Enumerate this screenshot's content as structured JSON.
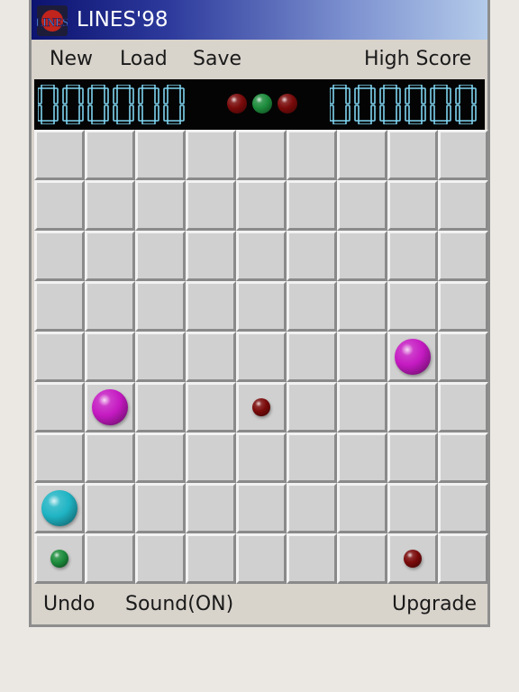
{
  "window": {
    "title": "LINES'98",
    "logo_text": "LINES"
  },
  "menu": {
    "new": "New",
    "load": "Load",
    "save": "Save",
    "high_score": "High Score"
  },
  "scores": {
    "current": "000000",
    "high": "000000"
  },
  "next_balls": [
    {
      "color": "#7a0a0a"
    },
    {
      "color": "#1d8c3c"
    },
    {
      "color": "#7a0a0a"
    }
  ],
  "board": {
    "rows": 9,
    "cols": 9,
    "balls": [
      {
        "row": 4,
        "col": 7,
        "color": "#c51ac2",
        "size": "large"
      },
      {
        "row": 5,
        "col": 1,
        "color": "#c51ac2",
        "size": "large"
      },
      {
        "row": 5,
        "col": 4,
        "color": "#7a0a0a",
        "size": "small"
      },
      {
        "row": 7,
        "col": 0,
        "color": "#1fb4c4",
        "size": "large"
      },
      {
        "row": 8,
        "col": 0,
        "color": "#1d8c3c",
        "size": "small"
      },
      {
        "row": 8,
        "col": 7,
        "color": "#7a0a0a",
        "size": "small"
      }
    ]
  },
  "bottom": {
    "undo": "Undo",
    "sound": "Sound(ON)",
    "upgrade": "Upgrade"
  },
  "colors": {
    "digit": "#7fd4f0",
    "title_bar_start": "#0c1370",
    "title_bar_end": "#b4cbea"
  }
}
